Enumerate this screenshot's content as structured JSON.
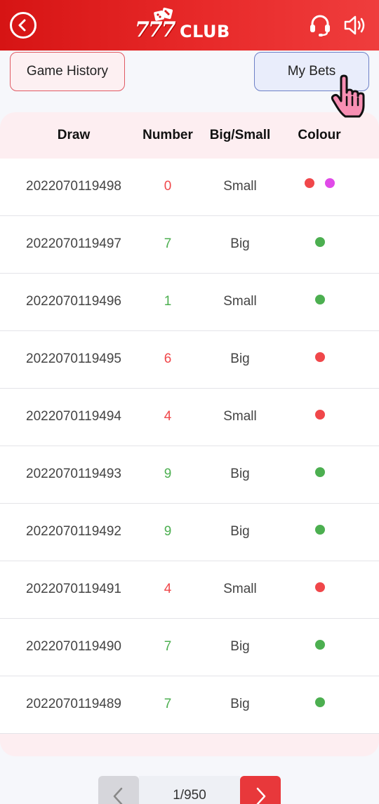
{
  "header": {
    "logo_sevens": "777",
    "logo_club": "CLUB",
    "colors": {
      "bar": "#e82a2a",
      "icon": "#ffffff"
    },
    "icons": [
      "back-icon",
      "dice-icon",
      "headset-icon",
      "speaker-icon"
    ]
  },
  "tabs": {
    "game_history": "Game History",
    "my_bets": "My Bets"
  },
  "table": {
    "columns": {
      "draw": "Draw",
      "number": "Number",
      "big_small": "Big/Small",
      "colour": "Colour"
    },
    "colors": {
      "red": "#f0474a",
      "green": "#4caf50",
      "violet": "#e04ae8"
    },
    "rows": [
      {
        "draw": "2022070119498",
        "number": "0",
        "big_small": "Small",
        "colours": [
          "red",
          "violet"
        ]
      },
      {
        "draw": "2022070119497",
        "number": "7",
        "big_small": "Big",
        "colours": [
          "green"
        ]
      },
      {
        "draw": "2022070119496",
        "number": "1",
        "big_small": "Small",
        "colours": [
          "green"
        ]
      },
      {
        "draw": "2022070119495",
        "number": "6",
        "big_small": "Big",
        "colours": [
          "red"
        ]
      },
      {
        "draw": "2022070119494",
        "number": "4",
        "big_small": "Small",
        "colours": [
          "red"
        ]
      },
      {
        "draw": "2022070119493",
        "number": "9",
        "big_small": "Big",
        "colours": [
          "green"
        ]
      },
      {
        "draw": "2022070119492",
        "number": "9",
        "big_small": "Big",
        "colours": [
          "green"
        ]
      },
      {
        "draw": "2022070119491",
        "number": "4",
        "big_small": "Small",
        "colours": [
          "red"
        ]
      },
      {
        "draw": "2022070119490",
        "number": "7",
        "big_small": "Big",
        "colours": [
          "green"
        ]
      },
      {
        "draw": "2022070119489",
        "number": "7",
        "big_small": "Big",
        "colours": [
          "green"
        ]
      }
    ]
  },
  "pagination": {
    "text": "1/950",
    "icons": [
      "chevron-left-icon",
      "chevron-right-icon"
    ]
  }
}
